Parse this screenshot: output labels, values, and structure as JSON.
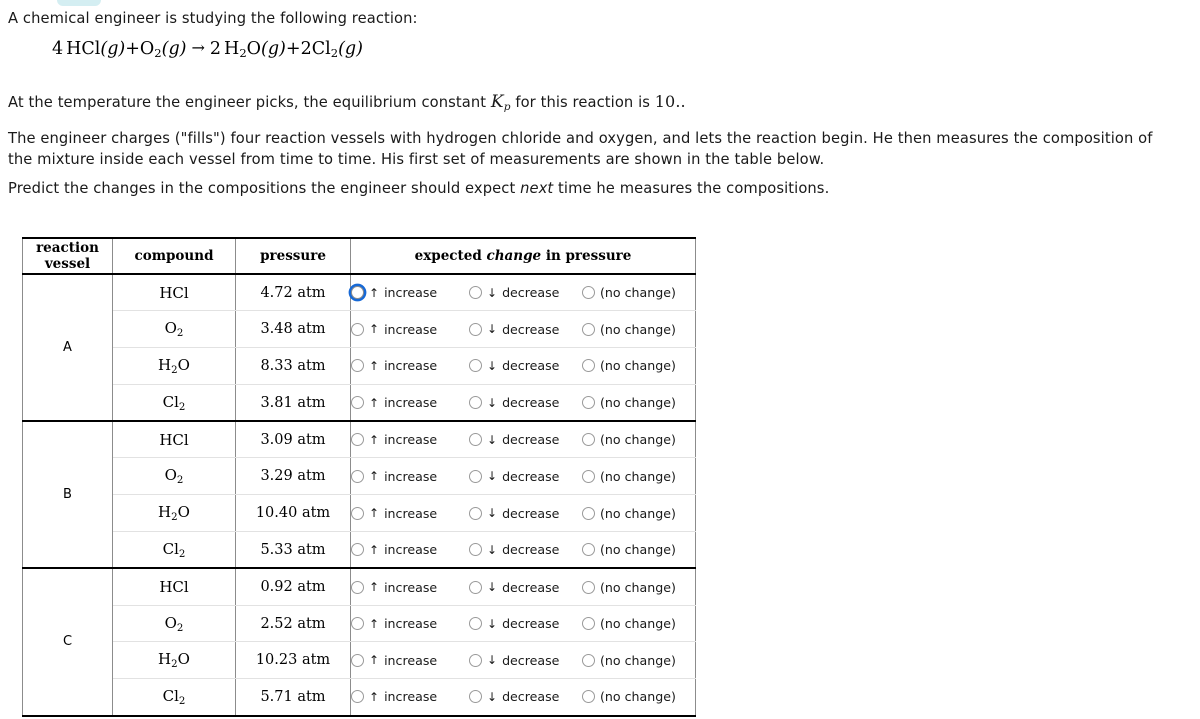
{
  "intro": {
    "line": "A chemical engineer is studying the following reaction:"
  },
  "equation": {
    "coeff_hcl": "4",
    "hcl": "HCl",
    "state_g_1": "(g)",
    "plus_1": "+",
    "o": "O",
    "o_sub": "2",
    "state_g_2": "(g)",
    "arrow": "→",
    "coeff_h2o": "2",
    "h": "H",
    "h_sub": "2",
    "o_label": "O",
    "state_g_3": "(g)",
    "plus_2": "+",
    "coeff_cl2": "2",
    "cl": "Cl",
    "cl_sub": "2",
    "state_g_4": "(g)"
  },
  "kp": {
    "prefix": "At the temperature the engineer picks, the equilibrium constant ",
    "symbol": "K",
    "subscript": "p",
    "middle": " for this reaction is ",
    "value": "10..",
    "suffix": ""
  },
  "paragraphs": {
    "charge": "The engineer charges (\"fills\") four reaction vessels with hydrogen chloride and oxygen, and lets the reaction begin. He then measures the composition of the mixture inside each vessel from time to time. His first set of measurements are shown in the table below.",
    "predict_before": "Predict the changes in the compositions the engineer should expect ",
    "predict_em": "next",
    "predict_after": " time he measures the compositions."
  },
  "table": {
    "headers": {
      "vessel_line1": "reaction",
      "vessel_line2": "vessel",
      "compound": "compound",
      "pressure": "pressure",
      "change_before": "expected ",
      "change_em": "change",
      "change_after": " in pressure"
    },
    "options": {
      "increase_arrow": "↑",
      "increase_label": "increase",
      "decrease_arrow": "↓",
      "decrease_label": "decrease",
      "nochange_label": "(no change)"
    },
    "groups": [
      {
        "vessel": "A",
        "rows": [
          {
            "formula": "HCl",
            "sub": "",
            "tail": "",
            "pressure": "4.72 atm",
            "focused": true
          },
          {
            "formula": "O",
            "sub": "2",
            "tail": "",
            "pressure": "3.48 atm",
            "focused": false
          },
          {
            "formula": "H",
            "sub": "2",
            "tail": "O",
            "pressure": "8.33 atm",
            "focused": false
          },
          {
            "formula": "Cl",
            "sub": "2",
            "tail": "",
            "pressure": "3.81 atm",
            "focused": false
          }
        ]
      },
      {
        "vessel": "B",
        "rows": [
          {
            "formula": "HCl",
            "sub": "",
            "tail": "",
            "pressure": "3.09 atm",
            "focused": false
          },
          {
            "formula": "O",
            "sub": "2",
            "tail": "",
            "pressure": "3.29 atm",
            "focused": false
          },
          {
            "formula": "H",
            "sub": "2",
            "tail": "O",
            "pressure": "10.40 atm",
            "focused": false
          },
          {
            "formula": "Cl",
            "sub": "2",
            "tail": "",
            "pressure": "5.33 atm",
            "focused": false
          }
        ]
      },
      {
        "vessel": "C",
        "rows": [
          {
            "formula": "HCl",
            "sub": "",
            "tail": "",
            "pressure": "0.92 atm",
            "focused": false
          },
          {
            "formula": "O",
            "sub": "2",
            "tail": "",
            "pressure": "2.52 atm",
            "focused": false
          },
          {
            "formula": "H",
            "sub": "2",
            "tail": "O",
            "pressure": "10.23 atm",
            "focused": false
          },
          {
            "formula": "Cl",
            "sub": "2",
            "tail": "",
            "pressure": "5.71 atm",
            "focused": false
          }
        ]
      }
    ]
  },
  "colors": {
    "focus_blue": "#1769d6",
    "artifact_tab": "#d4eef2",
    "border_strong": "#000000",
    "border_light": "#e2e2e2"
  }
}
